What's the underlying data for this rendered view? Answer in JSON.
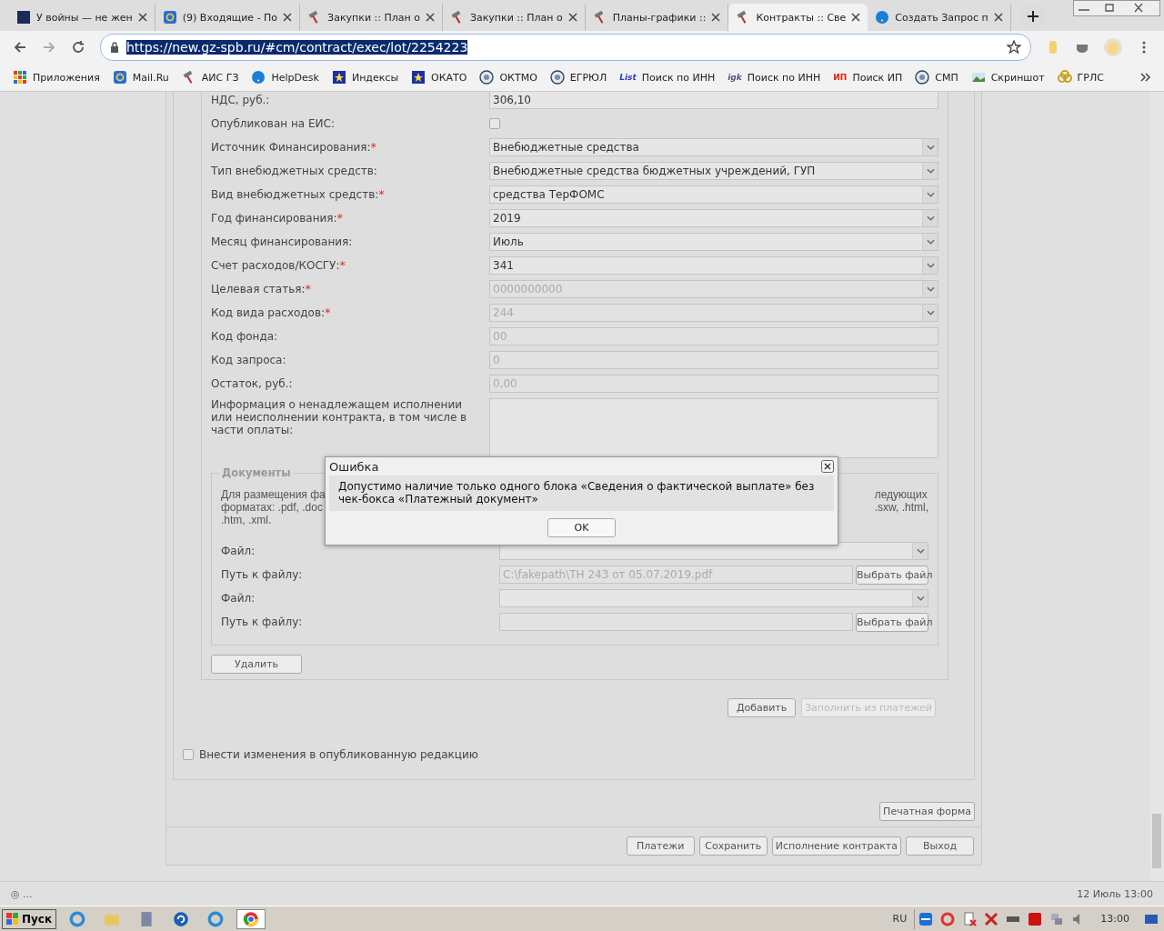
{
  "browser": {
    "tabs": [
      {
        "title": "У войны — не жен",
        "selected": false
      },
      {
        "title": "(9) Входящие - По",
        "selected": false
      },
      {
        "title": "Закупки :: План о",
        "selected": false
      },
      {
        "title": "Закупки :: План о",
        "selected": false
      },
      {
        "title": "Планы-графики ::",
        "selected": false
      },
      {
        "title": "Контракты :: Све",
        "selected": true
      },
      {
        "title": "Создать Запрос п",
        "selected": false
      }
    ],
    "address": "https://new.gz-spb.ru/#cm/contract/exec/lot/2254223",
    "bookmarks": [
      {
        "label": "Приложения"
      },
      {
        "label": "Mail.Ru"
      },
      {
        "label": "АИС ГЗ"
      },
      {
        "label": "HelpDesk"
      },
      {
        "label": "Индексы"
      },
      {
        "label": "ОКАТО"
      },
      {
        "label": "ОКТМО"
      },
      {
        "label": "ЕГРЮЛ"
      },
      {
        "label": "Поиск по ИНН",
        "icon_text": "List"
      },
      {
        "label": "Поиск по ИНН",
        "icon_text": "igk"
      },
      {
        "label": "Поиск ИП",
        "icon_text": "ИП"
      },
      {
        "label": "СМП"
      },
      {
        "label": "Скриншот"
      },
      {
        "label": "ГРЛС"
      }
    ]
  },
  "form": {
    "fields": [
      {
        "label": "НДС, руб.:",
        "kind": "text",
        "value": "306,10",
        "disabled": false
      },
      {
        "label": "Опубликован на ЕИС:",
        "kind": "checkbox",
        "checked": false
      },
      {
        "label": "Источник Финансирования:",
        "required_mark": "*",
        "kind": "select",
        "value": "Внебюджетные средства",
        "disabled": false
      },
      {
        "label": "Тип внебюджетных средств:",
        "kind": "select",
        "value": "Внебюджетные средства бюджетных учреждений, ГУП",
        "disabled": false
      },
      {
        "label": "Вид внебюджетных средств:",
        "required_mark": "*",
        "kind": "select",
        "value": "средства ТерФОМС",
        "disabled": false
      },
      {
        "label": "Год финансирования:",
        "required_mark": "*",
        "kind": "select",
        "value": "2019",
        "disabled": false
      },
      {
        "label": "Месяц финансирования:",
        "kind": "select",
        "value": "Июль",
        "disabled": false
      },
      {
        "label": "Счет расходов/КОСГУ:",
        "required_mark": "*",
        "kind": "select",
        "value": "341",
        "disabled": false
      },
      {
        "label": "Целевая статья:",
        "required_mark": "*",
        "kind": "select",
        "value": "0000000000",
        "disabled": true
      },
      {
        "label": "Код вида расходов:",
        "required_mark": "*",
        "kind": "select",
        "value": "244",
        "disabled": true
      },
      {
        "label": "Код фонда:",
        "kind": "text",
        "value": "00",
        "disabled": true
      },
      {
        "label": "Код запроса:",
        "kind": "text",
        "value": "0",
        "disabled": true
      },
      {
        "label": "Остаток, руб.:",
        "kind": "text",
        "value": "0,00",
        "disabled": true
      },
      {
        "label": "Информация о ненадлежащем исполнении или неисполнении контракта, в том числе в части оплаты:",
        "kind": "textarea"
      }
    ]
  },
  "documents": {
    "legend": "Документы",
    "description_left": [
      "Для размещения фа",
      "форматах: .pdf, .doc",
      ".htm, .xml."
    ],
    "description_right": [
      "ледующих",
      ".sxw, .html,"
    ],
    "files": [
      {
        "label": "Файл:",
        "kind": "select"
      },
      {
        "label": "Путь к файлу:",
        "kind": "path",
        "value": "C:\\fakepath\\ТН 243 от 05.07.2019.pdf",
        "button": "Выбрать файл"
      },
      {
        "label": "Файл:",
        "kind": "select"
      },
      {
        "label": "Путь к файлу:",
        "kind": "path",
        "button": "Выбрать файл"
      }
    ],
    "delete_button": "Удалить"
  },
  "actions": [
    {
      "label": "Добавить",
      "disabled": false
    },
    {
      "label": "Заполнить из платежей",
      "disabled": true
    }
  ],
  "republish": {
    "label": "Внести изменения в опубликованную редакцию",
    "checked": false
  },
  "print_button": "Печатная форма",
  "footer_buttons": [
    {
      "label": "Платежи"
    },
    {
      "label": "Сохранить"
    },
    {
      "label": "Исполнение контракта"
    },
    {
      "label": "Выход"
    }
  ],
  "dialog": {
    "title": "Ошибка",
    "message": "Допустимо наличие только одного блока «Сведения о фактической выплате» без чек-бокса «Платежный документ»",
    "ok": "OK"
  },
  "status_bar": {
    "left": "◎ ...",
    "right": "12 Июль 13:00"
  },
  "taskbar": {
    "start": "Пуск",
    "language": "RU",
    "clock": "13:00"
  }
}
